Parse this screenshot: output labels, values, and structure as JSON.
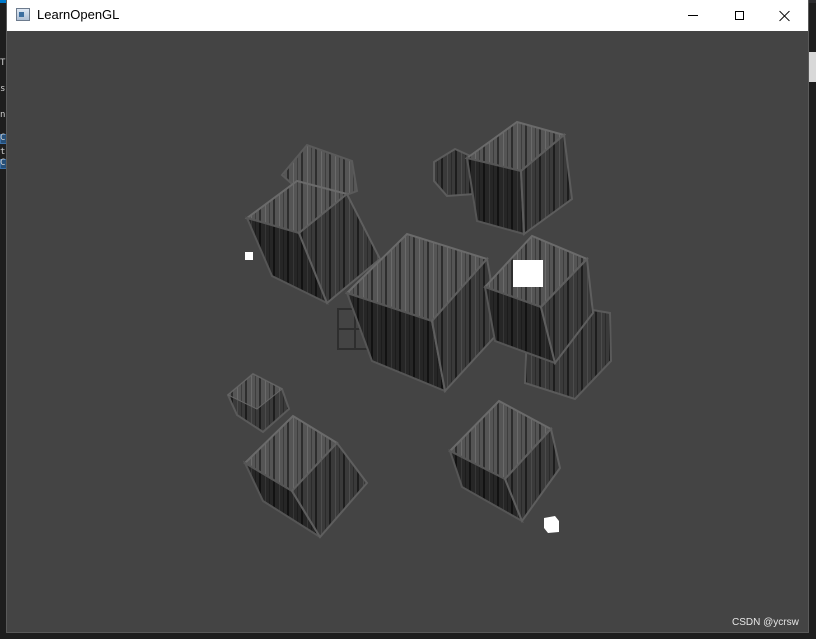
{
  "window": {
    "title": "LearnOpenGL",
    "icon": "opengl-app-icon",
    "buttons": {
      "minimize": "minimize-icon",
      "maximize": "maximize-icon",
      "close": "close-icon"
    }
  },
  "ide_background": {
    "left_chars": [
      "T",
      "s",
      "n",
      "C",
      "t",
      "C"
    ]
  },
  "scene": {
    "background_color": "#444444",
    "object": "wooden-crate",
    "light_color": "#ffffff"
  },
  "watermark": "CSDN @ycrsw"
}
